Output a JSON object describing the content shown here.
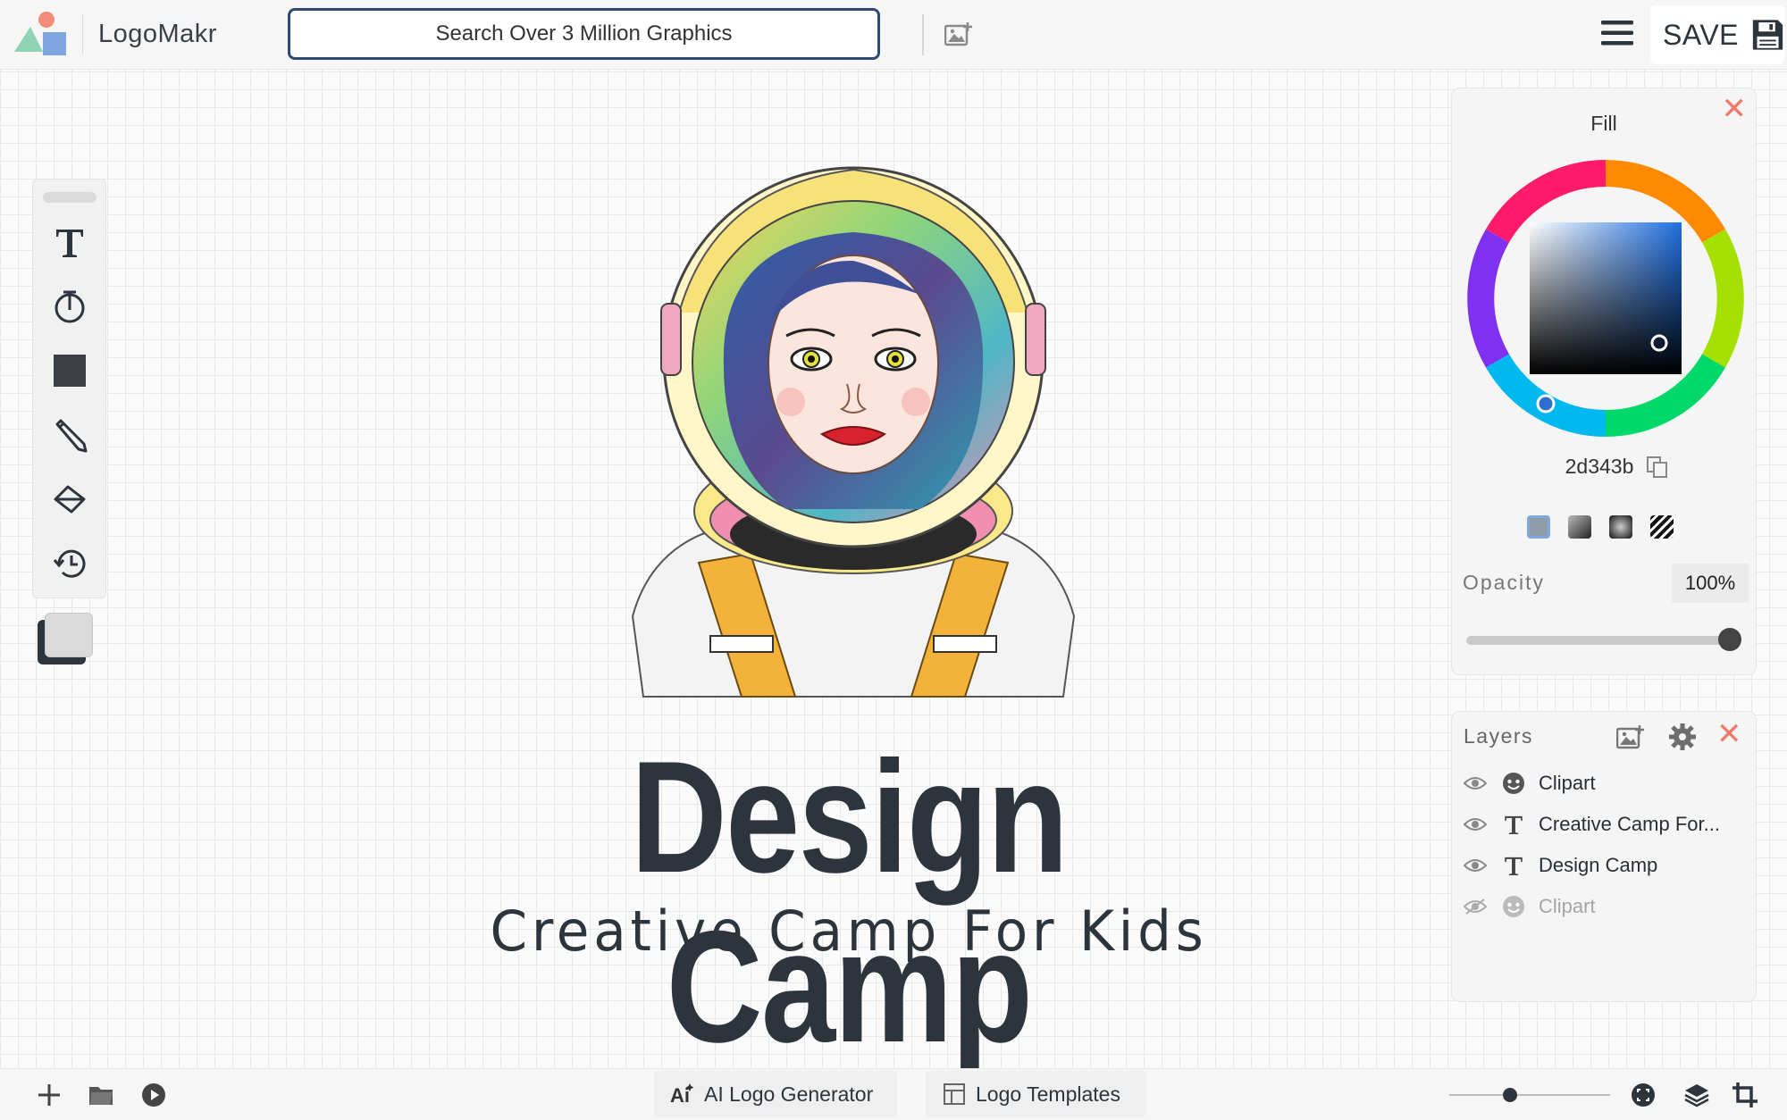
{
  "header": {
    "app_name": "LogoMakr",
    "search_placeholder": "Search Over 3 Million Graphics",
    "save_label": "SAVE"
  },
  "left_toolbar": {
    "tools": [
      "text-tool-icon",
      "shape-tool-icon",
      "square-tool-icon",
      "pencil-icon",
      "eraser-icon",
      "history-icon"
    ],
    "foreground_color": "#2d343b",
    "background_color": "#dadada"
  },
  "canvas": {
    "headline": "Design Camp",
    "tagline": "Creative Camp For Kids"
  },
  "fill_panel": {
    "title": "Fill",
    "hex": "2d343b",
    "opacity_label": "Opacity",
    "opacity_value": "100%",
    "opacity": 1.0,
    "fill_types": [
      "solid",
      "linear-gradient",
      "radial-gradient",
      "pattern"
    ]
  },
  "layers_panel": {
    "title": "Layers",
    "layers": [
      {
        "name": "Clipart",
        "type": "clipart",
        "visible": true
      },
      {
        "name": "Creative Camp For...",
        "type": "text",
        "visible": true
      },
      {
        "name": "Design Camp",
        "type": "text",
        "visible": true
      },
      {
        "name": "Clipart",
        "type": "clipart",
        "visible": false
      }
    ]
  },
  "bottom_bar": {
    "ai_logo_generator": "AI Logo Generator",
    "logo_templates": "Logo Templates",
    "zoom_level": 0.38
  },
  "colors": {
    "close_accent": "#f07a6a",
    "search_border": "#2f4a72",
    "text_dark": "#2d343b"
  }
}
